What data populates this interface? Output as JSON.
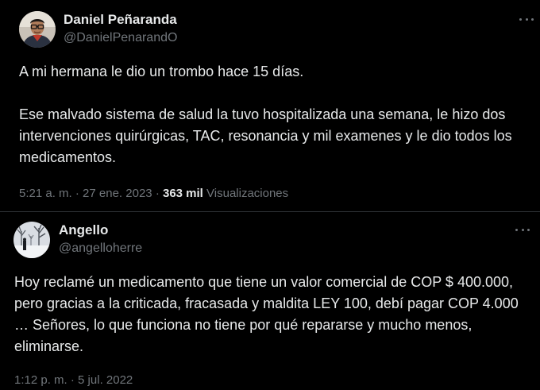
{
  "tweets": [
    {
      "display_name": "Daniel Peñaranda",
      "handle": "@DanielPenarandO",
      "paragraphs": [
        "A mi hermana le dio un trombo hace 15 días.",
        "Ese malvado sistema de salud la tuvo hospitalizada una semana, le hizo dos intervenciones quirúrgicas, TAC, resonancia y mil examenes y le dio todos los medicamentos."
      ],
      "time": "5:21 a. m.",
      "separator": "·",
      "date": "27 ene. 2023",
      "views_count": "363 mil",
      "views_label": "Visualizaciones",
      "avatar_icon": "profile-photo-man-glasses"
    },
    {
      "display_name": "Angello",
      "handle": "@angelloherre",
      "paragraphs": [
        "Hoy reclamé un medicamento que tiene un valor comercial de COP $ 400.000, pero gracias a la criticada, fracasada y maldita LEY 100, debí pagar COP 4.000 … Señores, lo que funciona no tiene por qué repararse y mucho menos, eliminarse."
      ],
      "time": "1:12 p. m.",
      "separator": "·",
      "date": "5 jul. 2022",
      "avatar_icon": "profile-photo-snowy-landscape"
    }
  ],
  "more_icon": "more-horizontal-icon",
  "colors": {
    "background": "#000000",
    "text": "#e7e9ea",
    "secondary": "#71767b",
    "divider": "#2f3336"
  }
}
